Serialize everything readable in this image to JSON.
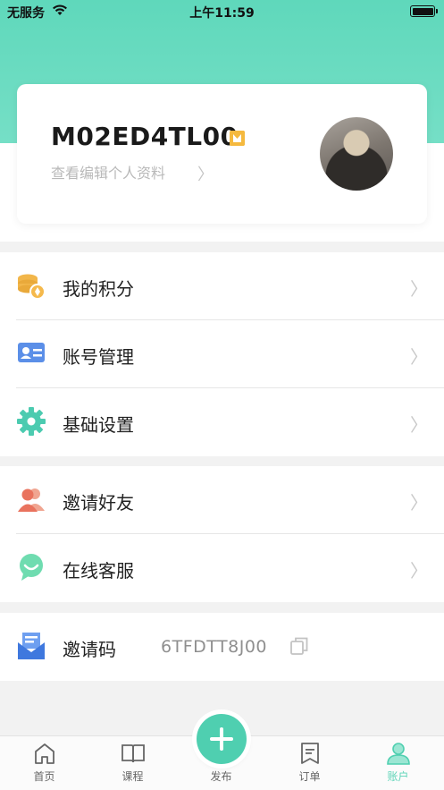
{
  "status_bar": {
    "carrier": "无服务",
    "time": "上午11:59",
    "icons": [
      "wifi-icon",
      "battery-icon"
    ]
  },
  "profile": {
    "username": "M02ED4TL00",
    "edit_link": "查看编辑个人资料",
    "chevron": "〉",
    "badge_color": "#f5b93e"
  },
  "menu_group_1": [
    {
      "label": "我的积分",
      "icon": "points-coins-icon",
      "chevron": "〉"
    },
    {
      "label": "账号管理",
      "icon": "id-card-icon",
      "chevron": "〉"
    },
    {
      "label": "基础设置",
      "icon": "gear-icon",
      "chevron": "〉"
    }
  ],
  "menu_group_2": [
    {
      "label": "邀请好友",
      "icon": "people-icon",
      "chevron": "〉"
    },
    {
      "label": "在线客服",
      "icon": "chat-bubble-icon",
      "chevron": "〉"
    }
  ],
  "invite": {
    "label": "邀请码",
    "code": "6TFDTT8J00",
    "icon": "envelope-icon",
    "copy_icon": "copy-icon"
  },
  "tab_bar": {
    "tabs": [
      {
        "label": "首页",
        "icon": "home-icon"
      },
      {
        "label": "课程",
        "icon": "book-icon"
      },
      {
        "label": "发布",
        "icon": "plus-icon"
      },
      {
        "label": "订单",
        "icon": "receipt-icon"
      },
      {
        "label": "账户",
        "icon": "user-icon",
        "active": true
      }
    ],
    "accent_color": "#4fcfb0"
  }
}
